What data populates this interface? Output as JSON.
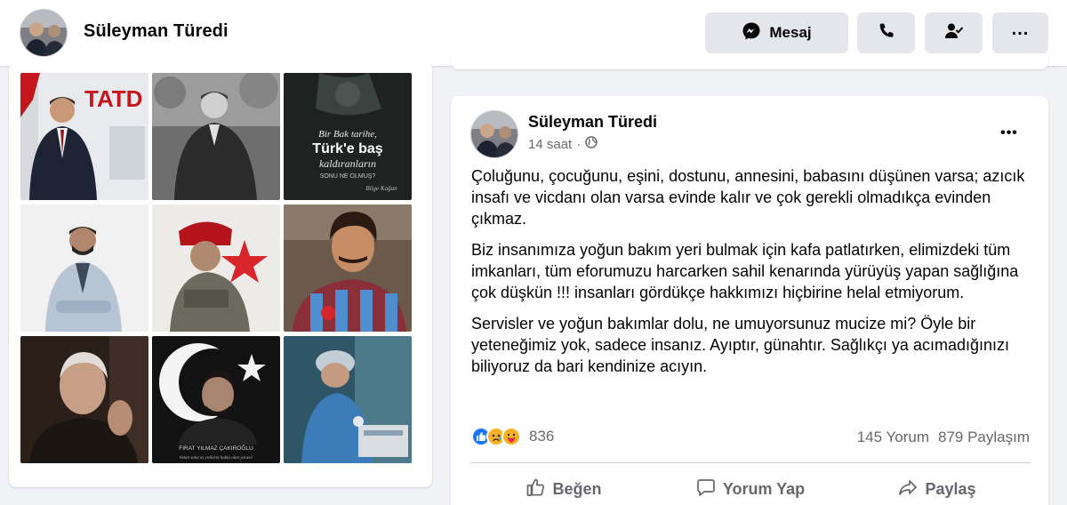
{
  "profile": {
    "name": "Süleyman Türedi"
  },
  "header_actions": {
    "message_label": "Mesaj",
    "call_icon": "phone-icon",
    "friend_icon": "friend-check-icon",
    "more_icon": "more-dots-icon"
  },
  "photos": {
    "items": [
      {
        "name": "photo-tatd-portrait",
        "caption": "TATD"
      },
      {
        "name": "photo-historic-portrait",
        "caption": ""
      },
      {
        "name": "photo-quote-poster",
        "caption_lines": [
          "Bir Bak tarihe,",
          "Türk'e baş",
          "kaldıranların",
          "SONU NE OLMUŞ?",
          "Bilge Kağan"
        ]
      },
      {
        "name": "photo-doctor-portrait",
        "caption": ""
      },
      {
        "name": "photo-soldier-art",
        "caption": ""
      },
      {
        "name": "photo-footballer-portrait",
        "caption": ""
      },
      {
        "name": "photo-praying-man",
        "caption": ""
      },
      {
        "name": "photo-crescent-star-portrait",
        "caption_lines": [
          "FIRAT YILMAZ ÇAKIROĞLU",
          "Vatan sana ey yolların hakla olan yarası!"
        ]
      },
      {
        "name": "photo-lab-researcher",
        "caption": ""
      }
    ]
  },
  "post": {
    "author": "Süleyman Türedi",
    "time": "14 saat",
    "separator": "·",
    "privacy_icon": "globe-icon",
    "menu_label": "•••",
    "paragraphs": [
      "Çoluğunu, çocuğunu, eşini, dostunu, annesini, babasını düşünen varsa; azıcık insafı ve vicdanı olan varsa evinde kalır ve çok gerekli olmadıkça evinden çıkmaz.",
      "Biz insanımıza yoğun bakım yeri bulmak için kafa patlatırken, elimizdeki tüm imkanları, tüm eforumuzu harcarken sahil kenarında yürüyüş yapan sağlığına çok düşkün !!! insanları gördükçe hakkımızı hiçbirine helal etmiyorum.",
      "Servisler ve yoğun bakımlar dolu, ne umuyorsunuz mucize mi? Öyle bir yeteneğimiz yok, sadece insanız. Ayıptır, günahtır. Sağlıkçı ya acımadığınızı biliyoruz da bari kendinize acıyın."
    ],
    "reactions": {
      "icons": [
        "like-reaction-icon",
        "sad-reaction-icon",
        "care-reaction-icon"
      ],
      "count": "836",
      "colors": {
        "like": "#1877f2",
        "sad": "#f7b125",
        "care": "#f7b125"
      }
    },
    "comments_label": "145 Yorum",
    "shares_label": "879 Paylaşım",
    "actions": {
      "like": "Beğen",
      "comment": "Yorum Yap",
      "share": "Paylaş"
    }
  }
}
